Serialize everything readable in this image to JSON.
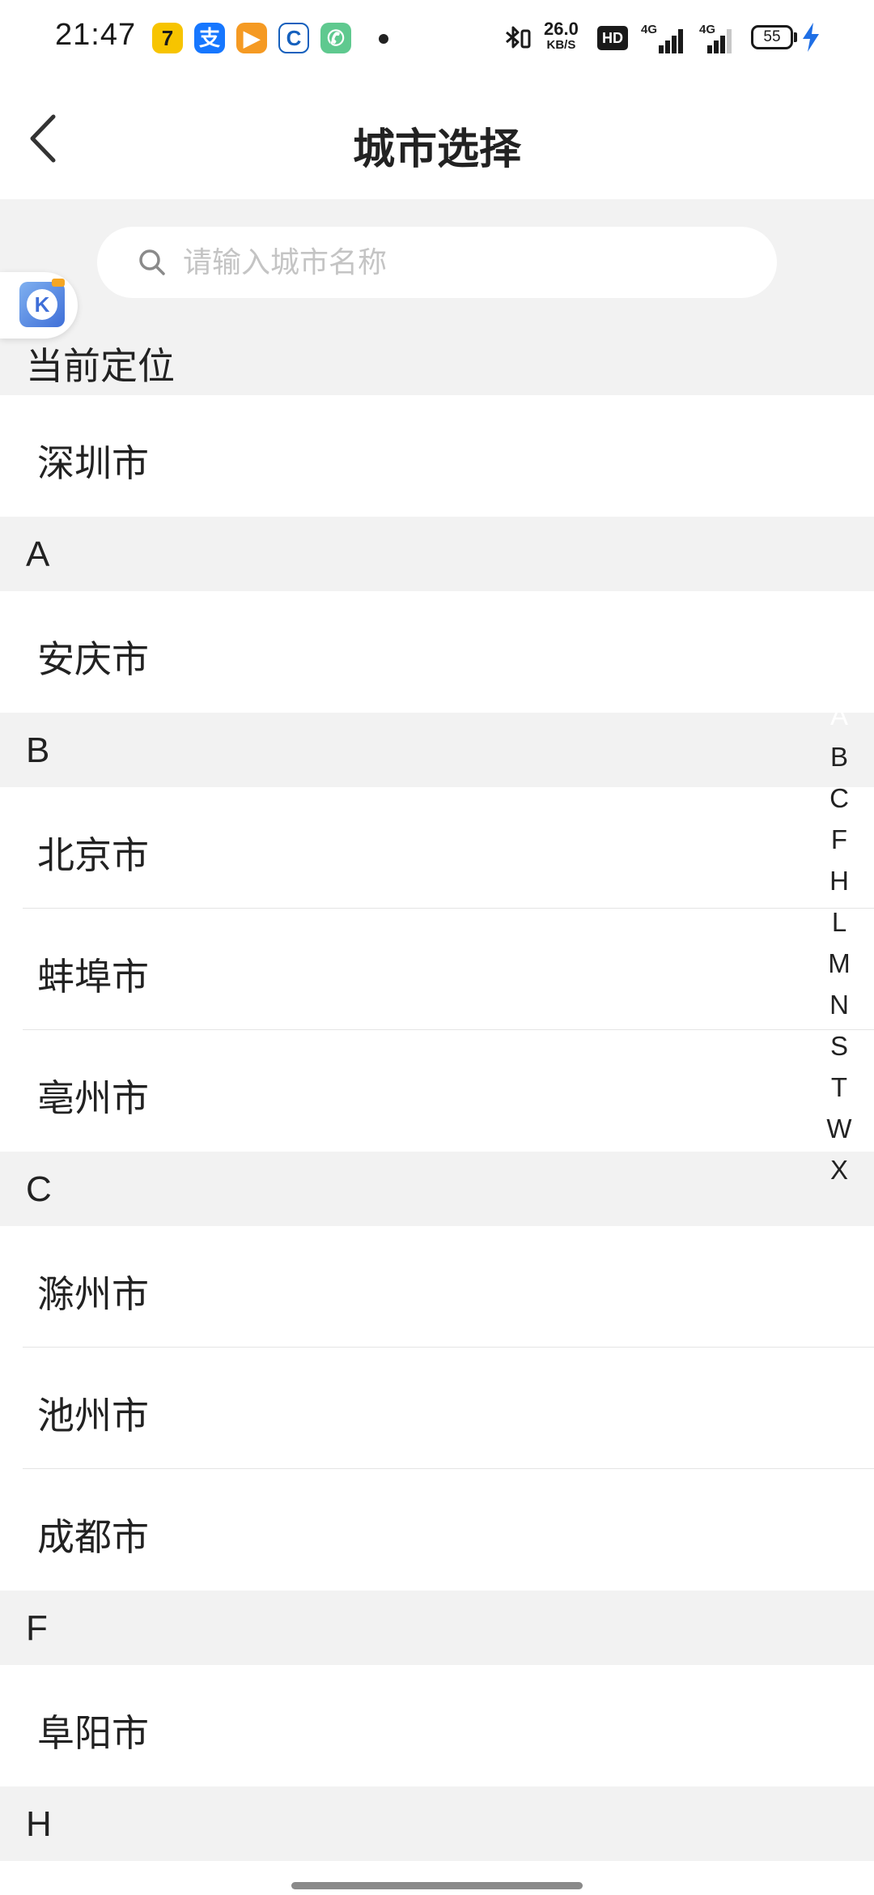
{
  "status_bar": {
    "time": "21:47",
    "net_speed_value": "26.0",
    "net_speed_unit": "KB/S",
    "hd_label": "HD",
    "signal_label_1": "4G",
    "signal_label_2": "4G",
    "battery": "55",
    "app_icons": [
      "qq-browser-icon",
      "alipay-icon",
      "video-app-icon",
      "bank-app-icon",
      "phone-app-icon"
    ]
  },
  "nav": {
    "title": "城市选择"
  },
  "search": {
    "placeholder": "请输入城市名称",
    "value": ""
  },
  "current_location": {
    "header": "当前定位",
    "city": "深圳市"
  },
  "sections": [
    {
      "letter": "A",
      "cities": [
        "安庆市"
      ]
    },
    {
      "letter": "B",
      "cities": [
        "北京市",
        "蚌埠市",
        "亳州市"
      ]
    },
    {
      "letter": "C",
      "cities": [
        "滁州市",
        "池州市",
        "成都市"
      ]
    },
    {
      "letter": "F",
      "cities": [
        "阜阳市"
      ]
    },
    {
      "letter": "H",
      "cities": []
    }
  ],
  "alpha_index": {
    "letters": [
      "A",
      "B",
      "C",
      "F",
      "H",
      "L",
      "M",
      "N",
      "S",
      "T",
      "W",
      "X"
    ],
    "active": "A",
    "active_color": "#ef3e33"
  },
  "colors": {
    "section_background": "#f2f2f2",
    "placeholder": "#c4c4c4"
  }
}
